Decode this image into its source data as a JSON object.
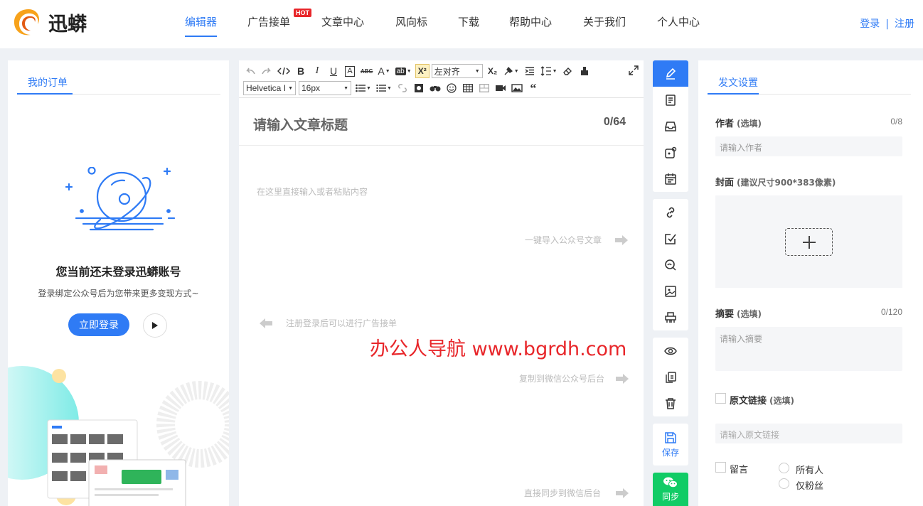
{
  "header": {
    "logo_text": "迅蟒",
    "nav": [
      {
        "label": "编辑器",
        "active": true
      },
      {
        "label": "广告接单"
      },
      {
        "label": "文章中心"
      },
      {
        "label": "风向标"
      },
      {
        "label": "下载"
      },
      {
        "label": "帮助中心"
      },
      {
        "label": "关于我们"
      },
      {
        "label": "个人中心"
      }
    ],
    "hot_badge": "HOT",
    "login": "登录",
    "separator": "|",
    "register": "注册"
  },
  "left_panel": {
    "tab": "我的订单",
    "title": "您当前还未登录迅蟒账号",
    "subtitle": "登录绑定公众号后为您带来更多变现方式~",
    "login_button": "立即登录"
  },
  "editor": {
    "toolbar": {
      "align_value": "左对齐",
      "font_family_value": "Helvetica I",
      "font_size_value": "16px",
      "abc_label": "ABC",
      "ab_label": "ab",
      "superscript_label": "X²",
      "subscript_label": "X₂"
    },
    "title_placeholder": "请输入文章标题",
    "title_count": "0/64",
    "content_placeholder": "在这里直接输入或者粘贴内容",
    "hints": {
      "import": "一键导入公众号文章",
      "ad": "注册登录后可以进行广告接单",
      "copy": "复制到微信公众号后台",
      "sync": "直接同步到微信后台"
    },
    "watermark": "办公人导航  www.bgrdh.com"
  },
  "tools": {
    "save_label": "保存",
    "sync_label": "同步"
  },
  "right_panel": {
    "tab": "发文设置",
    "author": {
      "label": "作者",
      "optional": "(选填)",
      "count": "0/8",
      "placeholder": "请输入作者"
    },
    "cover": {
      "label": "封面",
      "hint": "(建议尺寸900*383像素)"
    },
    "summary": {
      "label": "摘要",
      "optional": "(选填)",
      "count": "0/120",
      "placeholder": "请输入摘要"
    },
    "source_link": {
      "label": "原文链接",
      "optional": "(选填)",
      "placeholder": "请输入原文链接"
    },
    "comment": {
      "label": "留言",
      "options": [
        "所有人",
        "仅粉丝"
      ]
    }
  },
  "colors": {
    "accent": "#2f7bf5",
    "sync_green": "#11cc66",
    "hot_red": "#e8262a"
  }
}
